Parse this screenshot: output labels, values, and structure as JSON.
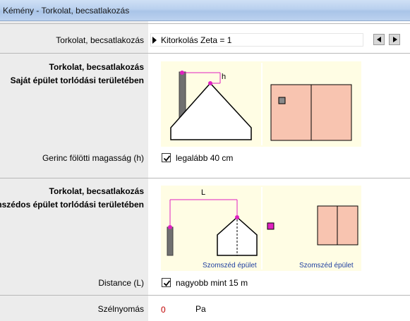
{
  "window": {
    "title": "Kémény - Torkolat, becsatlakozás"
  },
  "row_torkolat": {
    "label": "Torkolat, becsatlakozás",
    "selected_value": "Kitorkolás Zeta = 1"
  },
  "section1": {
    "title_line1": "Torkolat, becsatlakozás",
    "title_line2": "Saját épület torlódási területében",
    "diagram_h_label": "h"
  },
  "row_gerinc": {
    "label": "Gerinc fölötti magasság (h)",
    "checked": true,
    "checkbox_label": "legalább 40 cm"
  },
  "section2": {
    "title_line1": "Torkolat, becsatlakozás",
    "title_line2": "szomszédos épület torlódási területében",
    "diagram_L_label": "L",
    "caption_left": "Szomszéd épület",
    "caption_right": "Szomszéd épület"
  },
  "row_distance": {
    "label": "Distance (L)",
    "checked": true,
    "checkbox_label": "nagyobb mint 15 m"
  },
  "row_szel": {
    "label": "Szélnyomás",
    "value": "0",
    "unit": "Pa"
  },
  "colors": {
    "panel_bg": "#fffde4",
    "roof_fill": "#f8c4b0",
    "magenta": "#e020c0",
    "value_red": "#c00000"
  }
}
